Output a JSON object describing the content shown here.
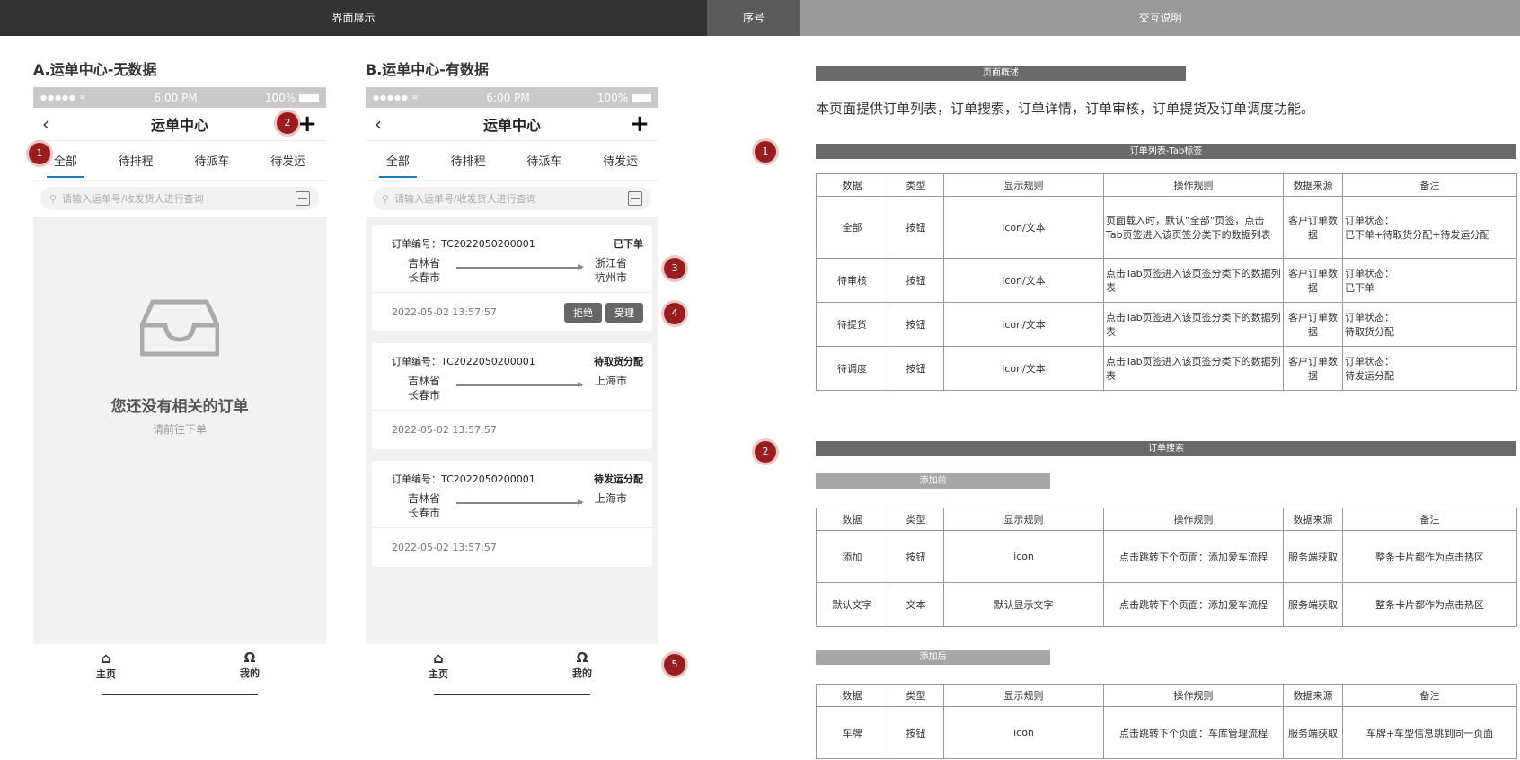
{
  "header": {
    "col1": "界面展示",
    "col2": "序号",
    "col3": "交互说明"
  },
  "sectionA": {
    "title": "A.运单中心-无数据"
  },
  "sectionB": {
    "title": "B.运单中心-有数据"
  },
  "phone": {
    "status_dots": "●●●●● ≋",
    "time": "6:00 PM",
    "battery": "100%",
    "nav_title": "运单中心",
    "back_icon": "chevron-left-icon",
    "add_icon": "plus-icon",
    "tabs": [
      "全部",
      "待排程",
      "待派车",
      "待发运"
    ],
    "search_placeholder": "请输入运单号/收发货人进行查询",
    "tabbar": {
      "home": "主页",
      "mine": "我的"
    }
  },
  "empty_state": {
    "title": "您还没有相关的订单",
    "subtitle": "请前往下单"
  },
  "orders": [
    {
      "no": "订单编号：TC2022050200001",
      "status": "已下单",
      "from1": "吉林省",
      "from2": "长春市",
      "to1": "浙江省",
      "to2": "杭州市",
      "time": "2022-05-02  13:57:57",
      "actions": [
        "拒绝",
        "受理"
      ]
    },
    {
      "no": "订单编号：TC2022050200001",
      "status": "待取货分配",
      "from1": "吉林省",
      "from2": "长春市",
      "to1": "上海市",
      "to2": "",
      "time": "2022-05-02  13:57:57",
      "actions": []
    },
    {
      "no": "订单编号：TC2022050200001",
      "status": "待发运分配",
      "from1": "吉林省",
      "from2": "长春市",
      "to1": "上海市",
      "to2": "",
      "time": "2022-05-02  13:57:57",
      "actions": []
    }
  ],
  "markers": [
    "1",
    "2",
    "3",
    "4",
    "5"
  ],
  "spec": {
    "overview_bar": "页面概述",
    "overview_text": "本页面提供订单列表，订单搜索，订单详情，订单审核，订单提货及订单调度功能。",
    "tab_bar": "订单列表-Tab标签",
    "search_bar": "订单搜索",
    "before_bar": "添加前",
    "after_bar": "添加后",
    "columns": [
      "数据",
      "类型",
      "显示规则",
      "操作规则",
      "数据来源",
      "备注"
    ],
    "tab_rows": [
      [
        "全部",
        "按钮",
        "icon/文本",
        "页面载入时，默认“全部”页签，点击Tab页签进入该页签分类下的数据列表",
        "客户订单数据",
        "订单状态：\n已下单+待取货分配+待发运分配"
      ],
      [
        "待审核",
        "按钮",
        "icon/文本",
        "点击Tab页签进入该页签分类下的数据列表",
        "客户订单数据",
        "订单状态：\n已下单"
      ],
      [
        "待提货",
        "按钮",
        "icon/文本",
        "点击Tab页签进入该页签分类下的数据列表",
        "客户订单数据",
        "订单状态：\n待取货分配"
      ],
      [
        "待调度",
        "按钮",
        "icon/文本",
        "点击Tab页签进入该页签分类下的数据列表",
        "客户订单数据",
        "订单状态：\n待发运分配"
      ]
    ],
    "before_rows": [
      [
        "添加",
        "按钮",
        "icon",
        "点击跳转下个页面：添加爱车流程",
        "服务端获取",
        "整条卡片都作为点击热区"
      ],
      [
        "默认文字",
        "文本",
        "默认显示文字",
        "点击跳转下个页面：添加爱车流程",
        "服务端获取",
        "整条卡片都作为点击热区"
      ]
    ],
    "after_rows": [
      [
        "车牌",
        "按钮",
        "icon",
        "点击跳转下个页面：车库管理流程",
        "服务端获取",
        "车牌+车型信息跳到同一页面"
      ]
    ]
  }
}
